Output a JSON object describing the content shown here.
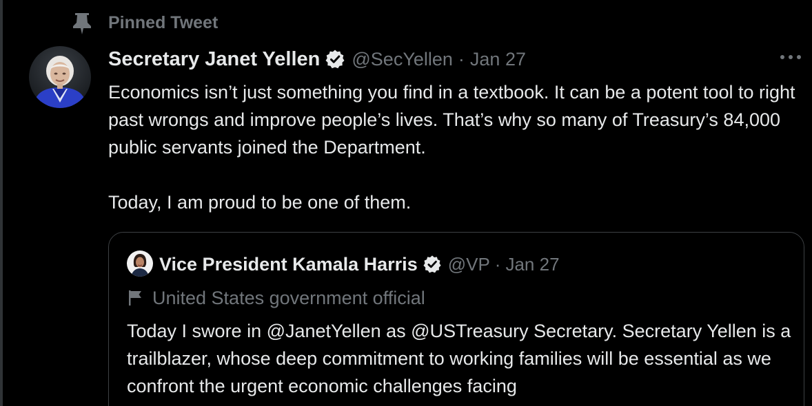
{
  "pinned": {
    "label": "Pinned Tweet",
    "icon": "pin-icon"
  },
  "tweet": {
    "author_name": "Secretary Janet Yellen",
    "verified_icon": "verified-badge-icon",
    "handle": "@SecYellen",
    "separator": "·",
    "date": "Jan 27",
    "more_icon": "more-options-icon",
    "text_paragraph_1": "Economics isn’t just something you find in a textbook. It can be a potent tool to right past wrongs and improve people’s lives. That’s why so many of Treasury’s 84,000 public servants joined the Department.",
    "text_paragraph_2": "Today, I am proud to be one of them."
  },
  "quoted_tweet": {
    "author_name": "Vice President Kamala Harris",
    "verified_icon": "verified-badge-icon",
    "handle": "@VP",
    "separator": "·",
    "date": "Jan 27",
    "label_icon": "flag-icon",
    "label": "United States government official",
    "text_before_mention_1": "Today I swore in ",
    "mention_1": "@JanetYellen",
    "text_between_mentions": " as ",
    "mention_2": "@USTreasury",
    "text_after_mentions": " Secretary. Secretary Yellen is a trailblazer, whose deep commitment to working families will be essential as we confront the urgent economic challenges facing"
  },
  "colors": {
    "background": "#000000",
    "primary_text": "#e7e9ea",
    "secondary_text": "#71767b",
    "border": "#3e4144"
  }
}
